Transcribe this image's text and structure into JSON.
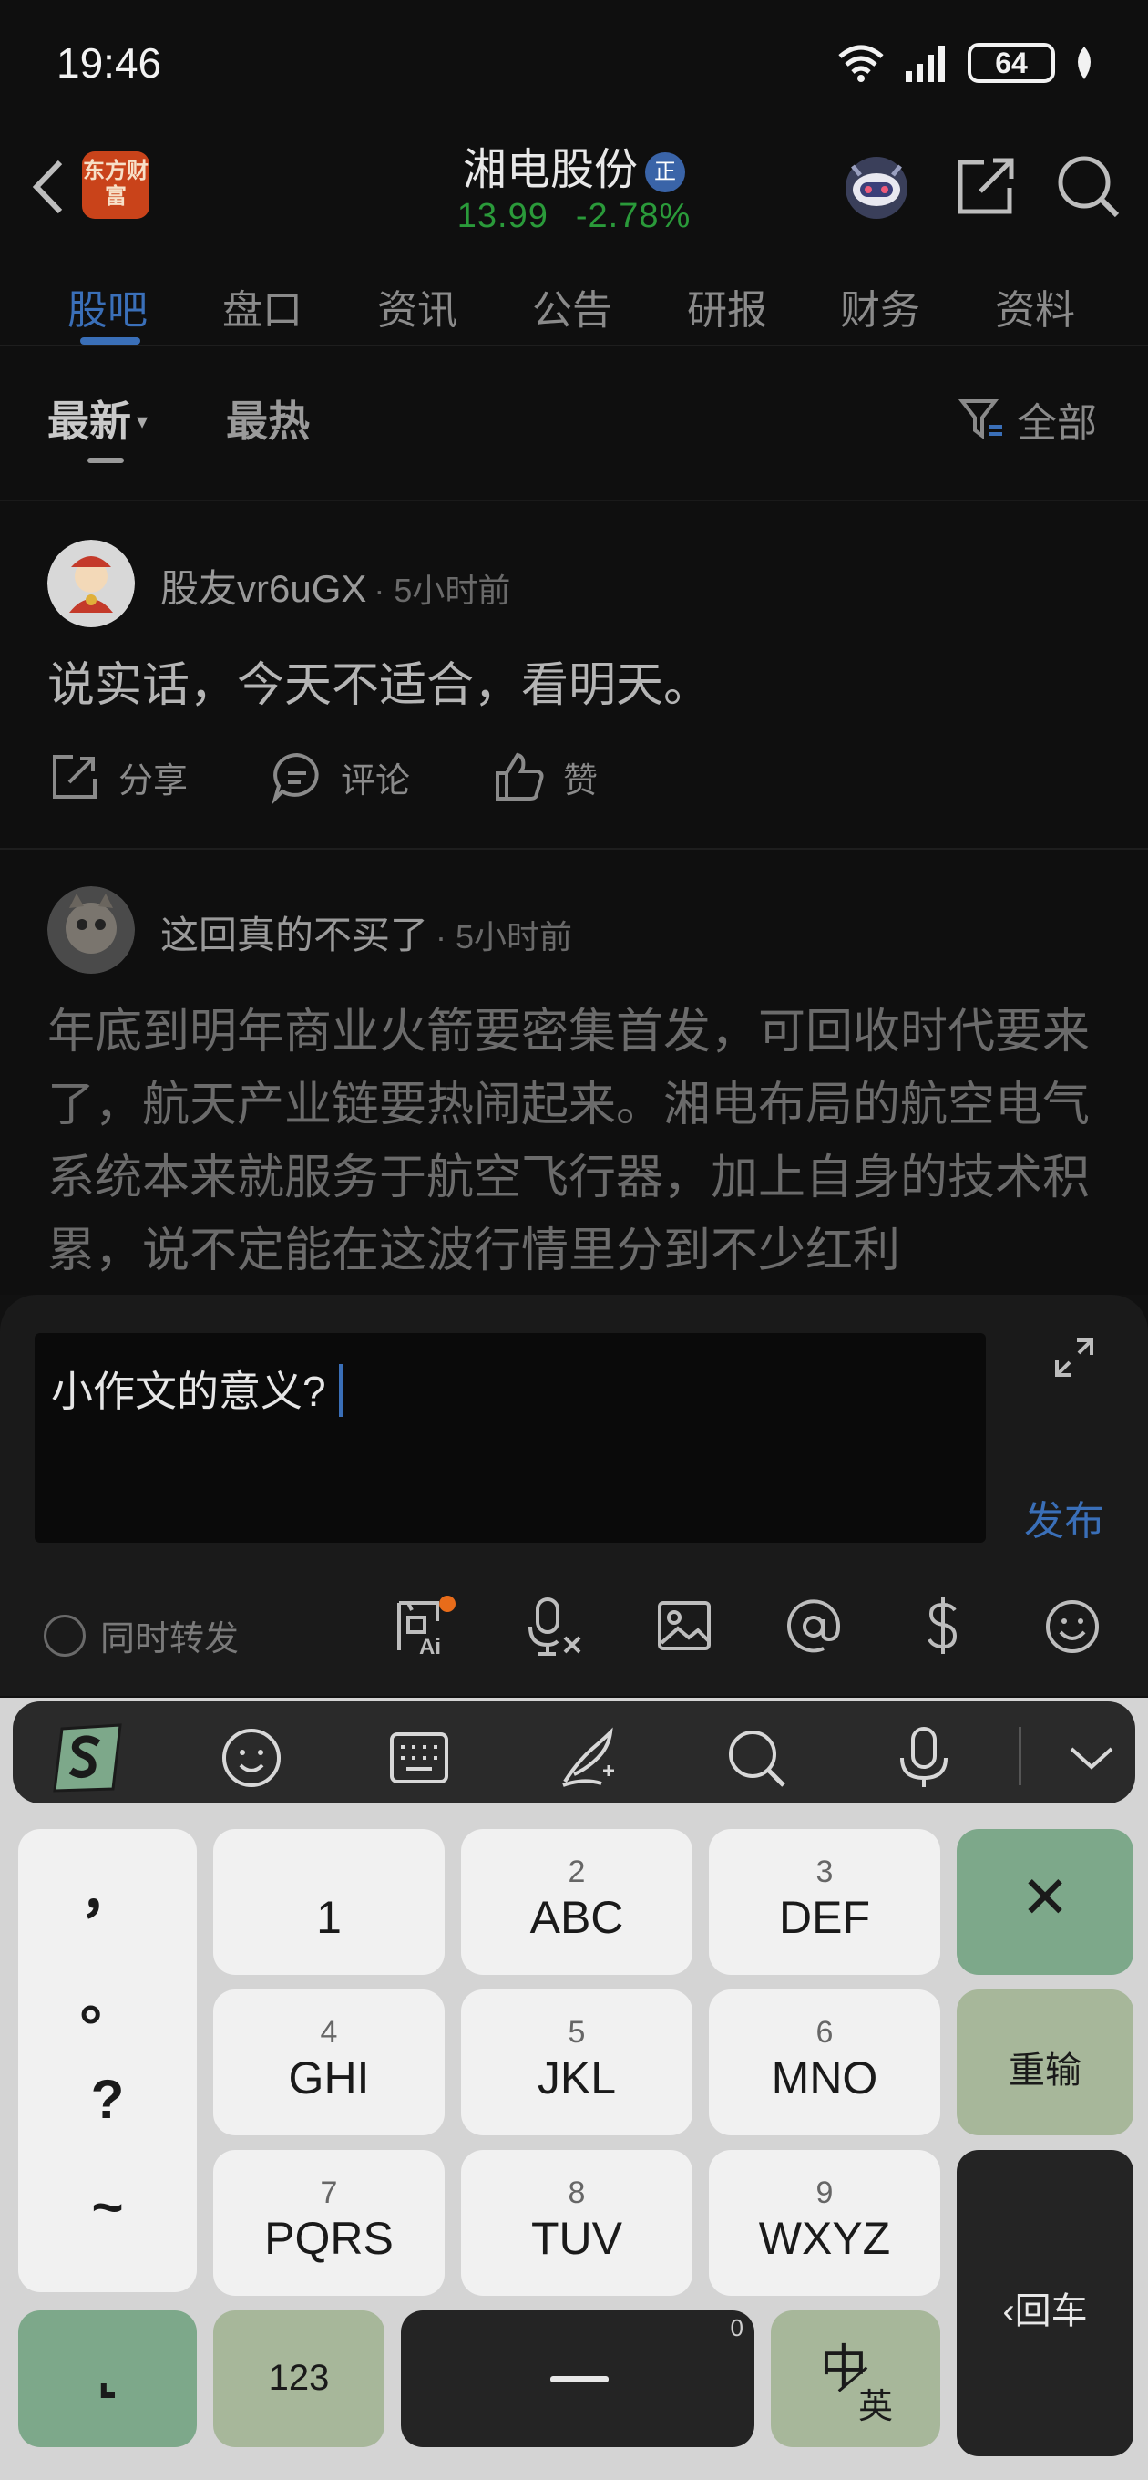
{
  "status": {
    "time": "19:46",
    "battery": "64"
  },
  "header": {
    "logo": "东方财富",
    "stock_name": "湘电股份",
    "badge": "正",
    "price": "13.99",
    "change": "-2.78%"
  },
  "tabs": [
    "股吧",
    "盘口",
    "资讯",
    "公告",
    "研报",
    "财务",
    "资料"
  ],
  "filter": {
    "latest": "最新",
    "hot": "最热",
    "all": "全部"
  },
  "posts": [
    {
      "author": "股友vr6uGX",
      "time": "· 5小时前",
      "body": "说实话，今天不适合，看明天。",
      "actions": {
        "share": "分享",
        "comment": "评论",
        "like": "赞"
      }
    },
    {
      "author": "这回真的不买了",
      "time": "· 5小时前",
      "body": "年底到明年商业火箭要密集首发，可回收时代要来了，航天产业链要热闹起来。湘电布局的航空电气系统本来就服务于航空飞行器，加上自身的技术积累，说不定能在这波行情里分到不少红利"
    }
  ],
  "composer": {
    "text": "小作文的意义?",
    "publish": "发布",
    "forward": "同时转发"
  },
  "keyboard": {
    "punct": [
      "，",
      "。",
      "?",
      "~"
    ],
    "keys": [
      {
        "num": "",
        "letters": "1"
      },
      {
        "num": "2",
        "letters": "ABC"
      },
      {
        "num": "3",
        "letters": "DEF"
      },
      {
        "num": "4",
        "letters": "GHI"
      },
      {
        "num": "5",
        "letters": "JKL"
      },
      {
        "num": "6",
        "letters": "MNO"
      },
      {
        "num": "7",
        "letters": "PQRS"
      },
      {
        "num": "8",
        "letters": "TUV"
      },
      {
        "num": "9",
        "letters": "WXYZ"
      }
    ],
    "delete": "✕",
    "reinput": "重输",
    "enter": "‹回车",
    "symbol": "⌞",
    "numbers": "123",
    "space_hint": "0",
    "lang_zh": "中",
    "lang_en": "英"
  },
  "colors": {
    "accent": "#3a6fb8",
    "price": "#2a9a3a",
    "brand": "#c9431a",
    "key_green": "#7da88a",
    "key_sage": "#a7b79a"
  }
}
